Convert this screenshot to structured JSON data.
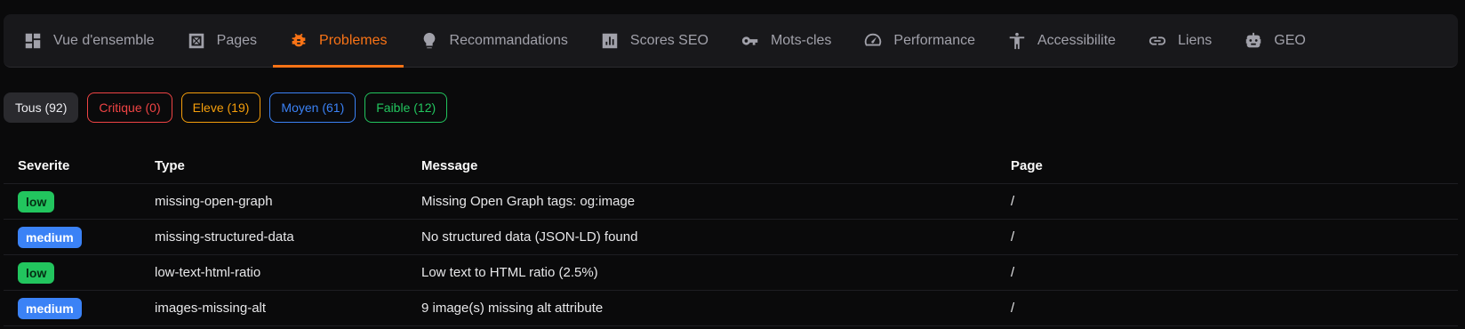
{
  "tabs": [
    {
      "label": "Vue d'ensemble",
      "icon": "dashboard-icon"
    },
    {
      "label": "Pages",
      "icon": "pages-icon"
    },
    {
      "label": "Problemes",
      "icon": "bug-icon",
      "active": true
    },
    {
      "label": "Recommandations",
      "icon": "lightbulb-icon"
    },
    {
      "label": "Scores SEO",
      "icon": "bar-chart-icon"
    },
    {
      "label": "Mots-cles",
      "icon": "key-icon"
    },
    {
      "label": "Performance",
      "icon": "speedometer-icon"
    },
    {
      "label": "Accessibilite",
      "icon": "accessibility-icon"
    },
    {
      "label": "Liens",
      "icon": "link-icon"
    },
    {
      "label": "GEO",
      "icon": "robot-icon"
    }
  ],
  "filters": {
    "all": "Tous (92)",
    "critical": "Critique (0)",
    "high": "Eleve (19)",
    "medium": "Moyen (61)",
    "low": "Faible (12)"
  },
  "table": {
    "headers": {
      "severity": "Severite",
      "type": "Type",
      "message": "Message",
      "page": "Page"
    },
    "rows": [
      {
        "severity": "low",
        "type": "missing-open-graph",
        "message": "Missing Open Graph tags: og:image",
        "page": "/"
      },
      {
        "severity": "medium",
        "type": "missing-structured-data",
        "message": "No structured data (JSON-LD) found",
        "page": "/"
      },
      {
        "severity": "low",
        "type": "low-text-html-ratio",
        "message": "Low text to HTML ratio (2.5%)",
        "page": "/"
      },
      {
        "severity": "medium",
        "type": "images-missing-alt",
        "message": "9 image(s) missing alt attribute",
        "page": "/"
      }
    ]
  },
  "colors": {
    "accent": "#f97316",
    "critical": "#ef4444",
    "high": "#f59e0b",
    "medium": "#3b82f6",
    "low": "#22c55e"
  }
}
